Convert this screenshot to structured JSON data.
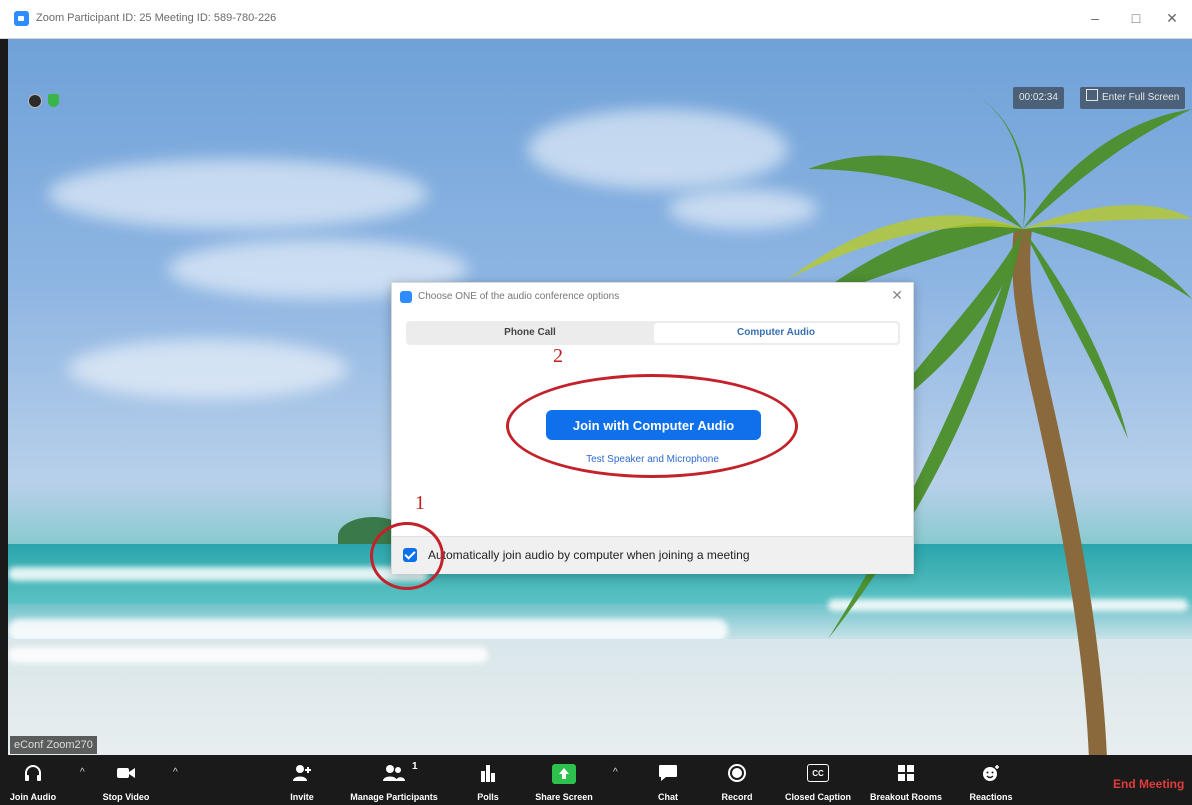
{
  "window": {
    "title": "Zoom Participant ID: 25   Meeting ID: 589-780-226",
    "min_glyph": "–",
    "max_glyph": "□",
    "close_glyph": "✕"
  },
  "video": {
    "timer": "00:02:34",
    "fullscreen_label": "Enter Full Screen",
    "participant_name": "eConf Zoom270"
  },
  "dialog": {
    "title": "Choose ONE of the audio conference options",
    "close_glyph": "✕",
    "tabs": [
      "Phone Call",
      "Computer Audio"
    ],
    "join_button": "Join with Computer Audio",
    "test_link": "Test Speaker and Microphone",
    "checkbox_label": "Automatically join audio by computer when joining a meeting",
    "checkbox_checked": true
  },
  "annotations": {
    "step1": "1",
    "step2": "2",
    "color": "#c4222a"
  },
  "toolbar": {
    "join_audio": "Join Audio",
    "stop_video": "Stop Video",
    "invite": "Invite",
    "manage_participants": "Manage Participants",
    "participants_count": "1",
    "polls": "Polls",
    "share_screen": "Share Screen",
    "chat": "Chat",
    "record": "Record",
    "closed_caption": "Closed Caption",
    "cc_glyph": "CC",
    "breakout_rooms": "Breakout Rooms",
    "reactions": "Reactions",
    "end_meeting": "End Meeting",
    "caret": "^"
  },
  "colors": {
    "accent": "#0e71eb",
    "end": "#e03c3c",
    "share": "#2ec14e"
  }
}
